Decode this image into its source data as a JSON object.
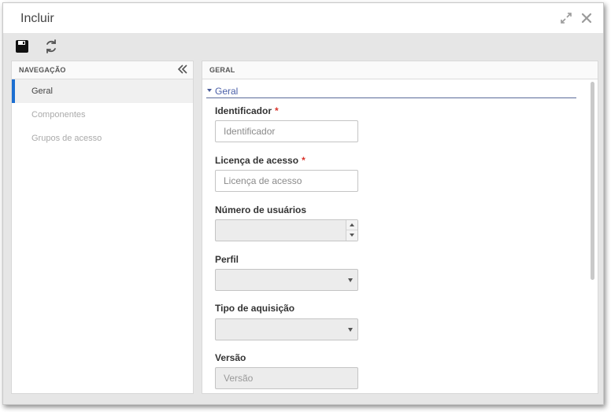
{
  "window": {
    "title": "Incluir",
    "icons": [
      "expand-icon",
      "close-icon"
    ]
  },
  "toolbar": {
    "icons": [
      "save-icon",
      "refresh-icon"
    ]
  },
  "navigation": {
    "header": "NAVEGAÇÃO",
    "items": [
      {
        "label": "Geral",
        "active": true
      },
      {
        "label": "Componentes",
        "active": false
      },
      {
        "label": "Grupos de acesso",
        "active": false
      }
    ]
  },
  "main": {
    "header": "GERAL",
    "section": "Geral",
    "fields": {
      "identificador": {
        "label": "Identificador",
        "required": "*",
        "placeholder": "Identificador",
        "value": ""
      },
      "licenca": {
        "label": "Licença de acesso",
        "required": "*",
        "placeholder": "Licença de acesso",
        "value": ""
      },
      "usuarios": {
        "label": "Número de usuários",
        "value": ""
      },
      "perfil": {
        "label": "Perfil",
        "value": ""
      },
      "aquisicao": {
        "label": "Tipo de aquisição",
        "value": ""
      },
      "versao": {
        "label": "Versão",
        "placeholder": "Versão",
        "value": ""
      }
    }
  },
  "colors": {
    "accent": "#1c6fd1",
    "required": "#d9342b",
    "section_link": "#4a5fa8"
  }
}
